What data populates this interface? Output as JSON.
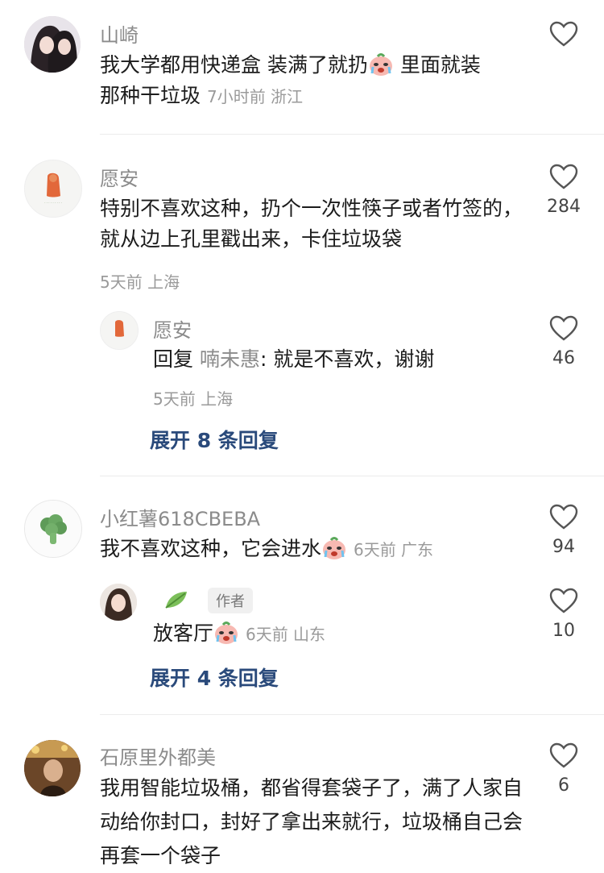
{
  "comments": [
    {
      "name": "山崎",
      "text_a": "我大学都用快递盒 装满了就扔",
      "text_b": " 里面就装",
      "text_c": "那种干垃圾",
      "meta": "7小时前 浙江"
    },
    {
      "name": "愿安",
      "text": "特别不喜欢这种，扔个一次性筷子或者竹签的，就从边上孔里戳出来，卡住垃圾袋",
      "meta": "5天前 上海",
      "likes": "284",
      "reply": {
        "name": "愿安",
        "prefix": "回复 ",
        "reply_to": "喃未惠",
        "text": ": 就是不喜欢，谢谢",
        "meta": "5天前 上海",
        "likes": "46"
      },
      "expand_label": "展开 8 条回复"
    },
    {
      "name": "小红薯618CBEBA",
      "text": "我不喜欢这种，它会进水",
      "meta": "6天前 广东",
      "likes": "94",
      "reply": {
        "author_tag": "作者",
        "text": "放客厅",
        "meta": "6天前 山东",
        "likes": "10"
      },
      "expand_label": "展开 4 条回复"
    },
    {
      "name": "石原里外都美",
      "text": "我用智能垃圾桶，都省得套袋子了，满了人家自动给你封口，封好了拿出来就行，垃圾桶自己会再套一个袋子",
      "likes": "6"
    }
  ],
  "colors": {
    "name": "#8b8b8b",
    "text": "#1c1c1c",
    "meta": "#9a9a9a",
    "expand": "#2a4a7b",
    "divider": "#ececec"
  }
}
